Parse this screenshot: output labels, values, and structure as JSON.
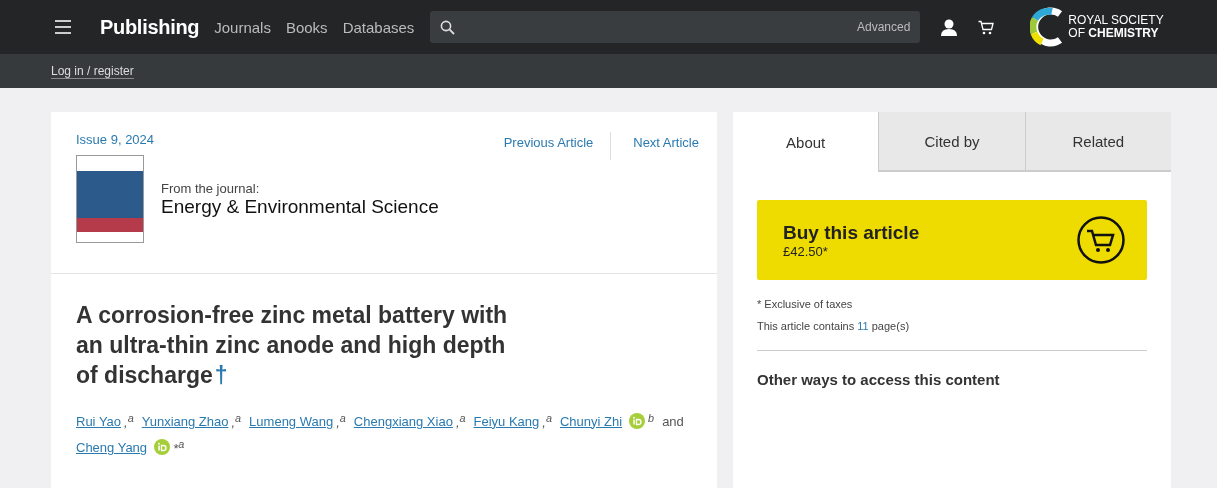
{
  "header": {
    "brand": "Publishing",
    "nav": [
      "Journals",
      "Books",
      "Databases"
    ],
    "search": {
      "advanced": "Advanced"
    },
    "logo": {
      "line1": "ROYAL SOCIETY",
      "line2_light": "OF",
      "line2_bold": "CHEMISTRY"
    }
  },
  "subbar": {
    "login": "Log in / register"
  },
  "article": {
    "issue": "Issue 9, 2024",
    "prev": "Previous Article",
    "next": "Next Article",
    "from": "From the journal:",
    "journal": "Energy & Environmental Science",
    "title": "A corrosion-free zinc metal battery with an ultra-thin zinc anode and high depth of discharge",
    "dagger": "†",
    "authors": [
      {
        "kind": "author",
        "name": "Rui Yao",
        "orcid": false,
        "suffix": ",$^{a}$"
      },
      {
        "kind": "author",
        "name": "Yunxiang Zhao",
        "orcid": false,
        "suffix": ",$^{a}$"
      },
      {
        "kind": "author",
        "name": "Lumeng Wang",
        "orcid": false,
        "suffix": ",$^{a}$"
      },
      {
        "kind": "author",
        "name": "Chengxiang Xiao",
        "orcid": false,
        "suffix": ",$^{a}$"
      },
      {
        "kind": "author",
        "name": "Feiyu Kang",
        "orcid": false,
        "suffix": ",$^{a}$"
      },
      {
        "kind": "author",
        "name": "Chunyi Zhi",
        "orcid": true,
        "suffix": "$^{b}$"
      },
      {
        "kind": "joiner",
        "name": "and"
      },
      {
        "kind": "author",
        "name": "Cheng Yang",
        "orcid": true,
        "suffix": "*$^{a}$"
      }
    ]
  },
  "sidebar": {
    "tabs": [
      {
        "label": "About",
        "selected": true
      },
      {
        "label": "Cited by",
        "selected": false
      },
      {
        "label": "Related",
        "selected": false
      }
    ],
    "buy": {
      "title": "Buy this article",
      "price": "£42.50*"
    },
    "tax_note": "* Exclusive of taxes",
    "pages_note": {
      "before": "This article contains",
      "count": "11",
      "after": "page(s)"
    },
    "other_heading": "Other ways to access this content"
  }
}
